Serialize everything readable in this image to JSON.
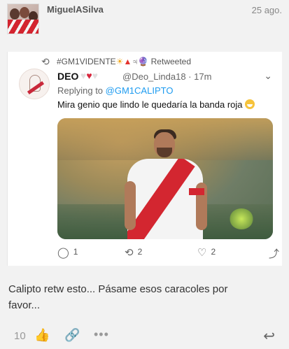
{
  "post": {
    "username": "MiguelASilva",
    "date": "25 ago.",
    "avatar_icon": "user-avatar"
  },
  "tweet": {
    "retweet_icon": "retweet-icon",
    "retweeter": "#GM1VIDENTE",
    "retweeter_emojis": "☀▲♃🔮",
    "retweeted_label": "Retweeted",
    "author_name": "DEO",
    "author_hearts": [
      "♡",
      "♥",
      "♡"
    ],
    "author_handle": "@Deo_Linda18",
    "time": "· 17m",
    "replying_label": "Replying to",
    "replying_handle": "@GM1CALIPTO",
    "text": "Mira genio que lindo le quedaría la banda roja",
    "media_description_icon": "photo-soccer-player",
    "actions": {
      "reply_count": "1",
      "retweet_count": "2",
      "like_count": "2"
    }
  },
  "comment": {
    "text": "Calipto retw esto... Pásame esos caracoles por favor..."
  },
  "footer": {
    "like_count": "10",
    "more_label": "•••"
  },
  "colors": {
    "link": "#1d9bf0",
    "heart_red": "#d7263d",
    "background": "#f2f2f2"
  }
}
